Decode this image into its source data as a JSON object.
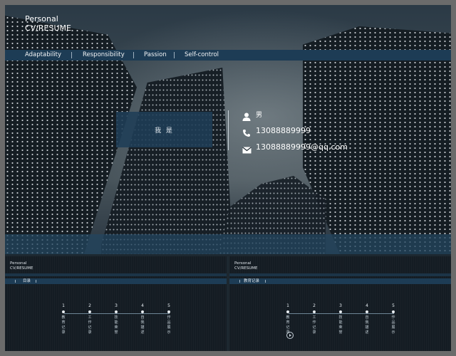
{
  "header": {
    "title_line1": "Personal",
    "title_line2": "CV/RESUME"
  },
  "nav": {
    "items": [
      "Adaptability",
      "Responsibility",
      "Passion",
      "Self-control"
    ]
  },
  "card": {
    "label": "我 是"
  },
  "info": {
    "gender": "男",
    "phone": "13088889999",
    "email": "13088889999@qq.com"
  },
  "thumb_left": {
    "title_line1": "Personal",
    "title_line2": "CV/RESUME",
    "section": "目录",
    "steps": [
      {
        "num": "1",
        "label": "教育记录"
      },
      {
        "num": "2",
        "label": "工作记录"
      },
      {
        "num": "3",
        "label": "技能荣誉"
      },
      {
        "num": "4",
        "label": "自我描述"
      },
      {
        "num": "5",
        "label": "作品展示"
      }
    ]
  },
  "thumb_right": {
    "title_line1": "Personal",
    "title_line2": "CV/RESUME",
    "section": "教育记录",
    "steps": [
      {
        "num": "1",
        "label": "教育记录"
      },
      {
        "num": "2",
        "label": "工作记录"
      },
      {
        "num": "3",
        "label": "技能荣誉"
      },
      {
        "num": "4",
        "label": "自我描述"
      },
      {
        "num": "5",
        "label": "作品展示"
      }
    ]
  },
  "icons": {
    "person": "person-icon",
    "phone": "phone-icon",
    "email": "mail-icon",
    "play": "play-icon"
  }
}
